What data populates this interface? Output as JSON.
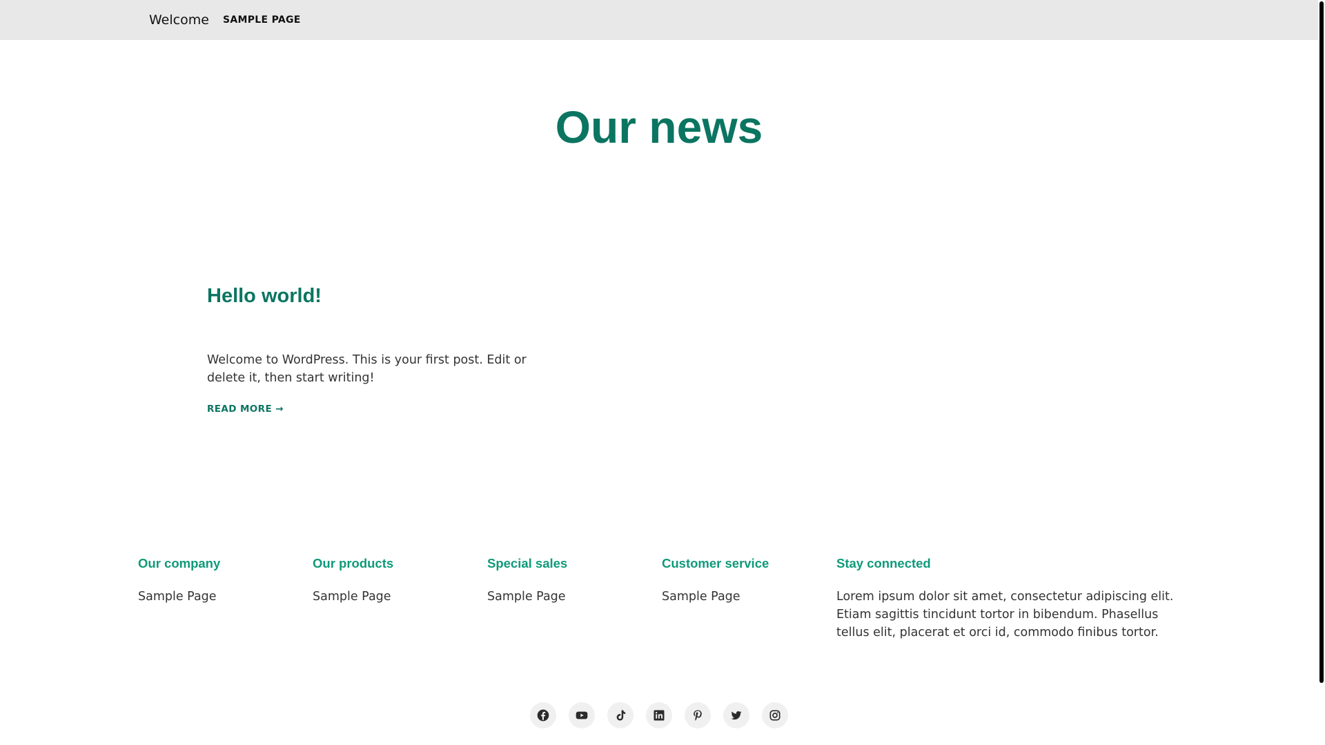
{
  "header": {
    "site_title": "Welcome",
    "nav_items": [
      "SAMPLE PAGE"
    ]
  },
  "main": {
    "heading": "Our news",
    "posts": [
      {
        "title": "Hello world!",
        "excerpt": "Welcome to WordPress. This is your first post. Edit or delete it, then start writing!",
        "read_more": "READ MORE →"
      }
    ]
  },
  "footer": {
    "columns": [
      {
        "heading": "Our company",
        "link": "Sample Page"
      },
      {
        "heading": "Our products",
        "link": "Sample Page"
      },
      {
        "heading": "Special sales",
        "link": "Sample Page"
      },
      {
        "heading": "Customer service",
        "link": "Sample Page"
      }
    ],
    "stay_connected": {
      "heading": "Stay connected",
      "text": "Lorem ipsum dolor sit amet, consectetur adipiscing elit. Etiam sagittis tincidunt tortor in bibendum. Phasellus tellus elit, placerat et orci id, commodo finibus tortor."
    },
    "social_icons": [
      "facebook-icon",
      "youtube-icon",
      "tiktok-icon",
      "linkedin-icon",
      "pinterest-icon",
      "twitter-icon",
      "instagram-icon"
    ]
  },
  "colors": {
    "accent_dark": "#0b7561",
    "accent_light": "#0e9a7a",
    "header_bg": "#e8e8e8",
    "text": "#333333"
  }
}
